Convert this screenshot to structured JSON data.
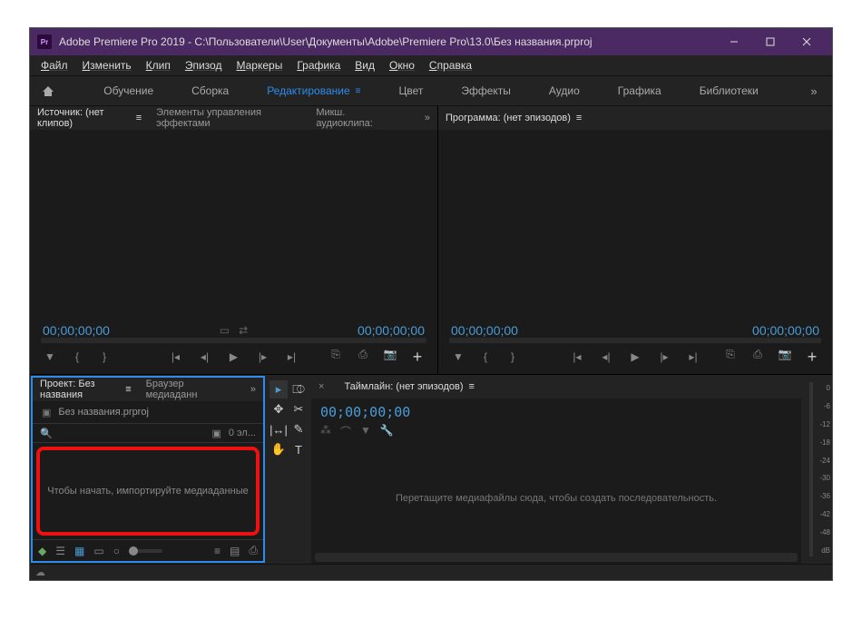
{
  "titlebar": {
    "app_abbrev": "Pr",
    "title": "Adobe Premiere Pro 2019 - C:\\Пользователи\\User\\Документы\\Adobe\\Premiere Pro\\13.0\\Без названия.prproj"
  },
  "menubar": [
    "Файл",
    "Изменить",
    "Клип",
    "Эпизод",
    "Маркеры",
    "Графика",
    "Вид",
    "Окно",
    "Справка"
  ],
  "workspaces": {
    "items": [
      "Обучение",
      "Сборка",
      "Редактирование",
      "Цвет",
      "Эффекты",
      "Аудио",
      "Графика",
      "Библиотеки"
    ],
    "active_index": 2
  },
  "source_panel": {
    "tabs": {
      "source": "Источник: (нет клипов)",
      "effects": "Элементы управления эффектами",
      "mixer": "Микш. аудиоклипа:"
    },
    "tc_left": "00;00;00;00",
    "tc_right": "00;00;00;00"
  },
  "program_panel": {
    "tab": "Программа: (нет эпизодов)",
    "tc_left": "00;00;00;00",
    "tc_right": "00;00;00;00"
  },
  "project_panel": {
    "tab_project": "Проект: Без названия",
    "tab_browser": "Браузер медиаданн",
    "filename": "Без названия.prproj",
    "item_count": "0 эл...",
    "hint": "Чтобы начать, импортируйте медиаданные"
  },
  "timeline_panel": {
    "tab": "Таймлайн: (нет эпизодов)",
    "tc": "00;00;00;00",
    "hint": "Перетащите медиафайлы сюда, чтобы создать последовательность."
  },
  "audio_meter": {
    "ticks": [
      "0",
      "-6",
      "-12",
      "-18",
      "-24",
      "-30",
      "-36",
      "-42",
      "-48",
      "dB"
    ]
  }
}
